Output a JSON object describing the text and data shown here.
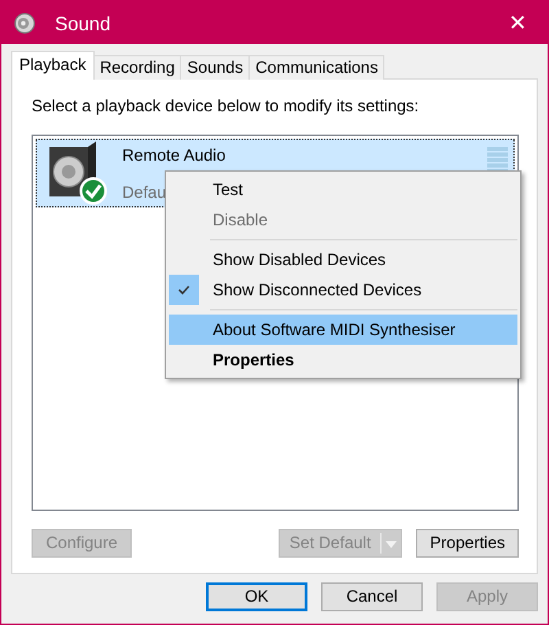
{
  "window": {
    "title": "Sound",
    "close": "✕"
  },
  "tabs": [
    {
      "label": "Playback",
      "selected": true
    },
    {
      "label": "Recording",
      "selected": false
    },
    {
      "label": "Sounds",
      "selected": false
    },
    {
      "label": "Communications",
      "selected": false
    }
  ],
  "instruction": "Select a playback device below to modify its settings:",
  "devices": [
    {
      "name": "Remote Audio",
      "status": "Defau",
      "selected": true,
      "default": true
    }
  ],
  "context_menu": [
    {
      "kind": "item",
      "label": "Test",
      "checked": false,
      "disabled": false,
      "selected": false,
      "default": false
    },
    {
      "kind": "item",
      "label": "Disable",
      "checked": false,
      "disabled": true,
      "selected": false,
      "default": false
    },
    {
      "kind": "separator"
    },
    {
      "kind": "item",
      "label": "Show Disabled Devices",
      "checked": false,
      "disabled": false,
      "selected": false,
      "default": false
    },
    {
      "kind": "item",
      "label": "Show Disconnected Devices",
      "checked": true,
      "disabled": false,
      "selected": false,
      "default": false
    },
    {
      "kind": "separator"
    },
    {
      "kind": "item",
      "label": "About Software MIDI Synthesiser",
      "checked": false,
      "disabled": false,
      "selected": true,
      "default": false
    },
    {
      "kind": "item",
      "label": "Properties",
      "checked": false,
      "disabled": false,
      "selected": false,
      "default": true
    }
  ],
  "panel_buttons": [
    {
      "kind": "button",
      "label": "Configure",
      "disabled": true
    },
    {
      "kind": "split",
      "label": "Set Default",
      "disabled": true
    },
    {
      "kind": "button",
      "label": "Properties",
      "disabled": false
    }
  ],
  "dialog_buttons": [
    {
      "label": "OK",
      "disabled": false,
      "focused": true
    },
    {
      "label": "Cancel",
      "disabled": false,
      "focused": false
    },
    {
      "label": "Apply",
      "disabled": true,
      "focused": false
    }
  ]
}
